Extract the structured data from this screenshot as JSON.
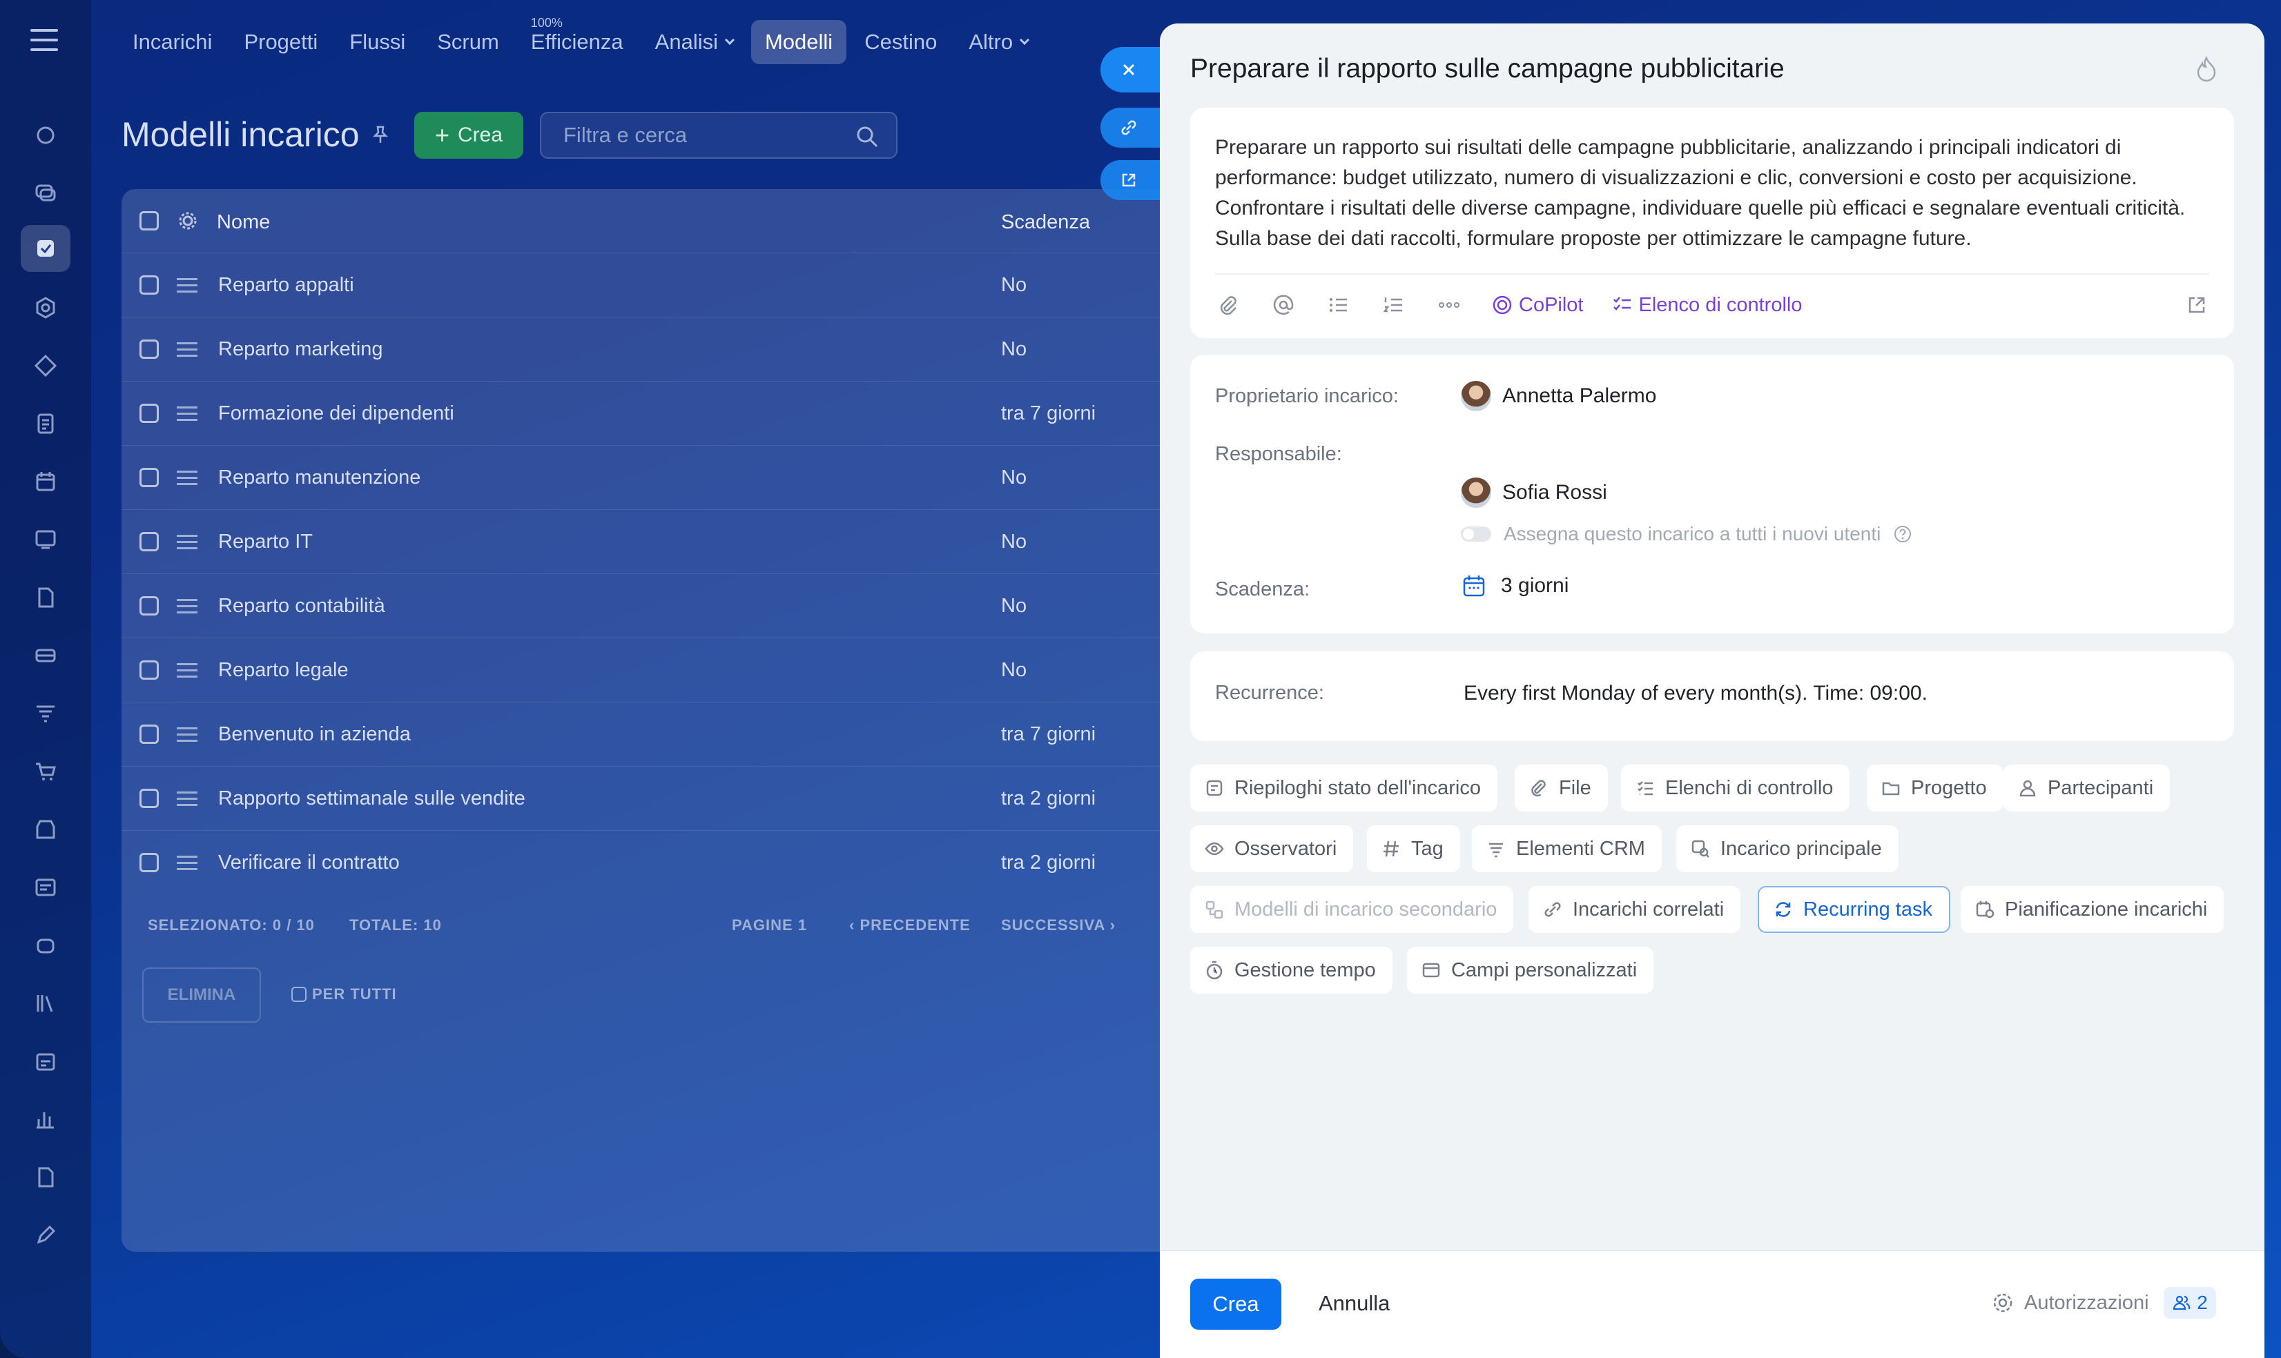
{
  "nav": {
    "items": [
      "Incarichi",
      "Progetti",
      "Flussi",
      "Scrum",
      "Efficienza",
      "Analisi",
      "Modelli",
      "Cestino",
      "Altro"
    ],
    "efficiency_sup": "100%"
  },
  "page": {
    "title": "Modelli incarico",
    "create_label": "Crea",
    "search_placeholder": "Filtra e cerca"
  },
  "grid": {
    "col_name": "Nome",
    "col_due": "Scadenza",
    "rows": [
      {
        "name": "Reparto appalti",
        "due": "No"
      },
      {
        "name": "Reparto marketing",
        "due": "No"
      },
      {
        "name": "Formazione dei dipendenti",
        "due": "tra 7 giorni"
      },
      {
        "name": "Reparto manutenzione",
        "due": "No"
      },
      {
        "name": "Reparto IT",
        "due": "No"
      },
      {
        "name": "Reparto contabilità",
        "due": "No"
      },
      {
        "name": "Reparto legale",
        "due": "No"
      },
      {
        "name": "Benvenuto in azienda",
        "due": "tra 7 giorni"
      },
      {
        "name": "Rapporto settimanale sulle vendite",
        "due": "tra 2 giorni"
      },
      {
        "name": "Verificare il contratto",
        "due": "tra 2 giorni"
      }
    ],
    "footer": {
      "selected": "SELEZIONATO: 0 / 10",
      "total": "TOTALE: 10",
      "pages": "PAGINE  1",
      "prev": "PRECEDENTE",
      "next": "SUCCESSIVA",
      "delete": "ELIMINA",
      "for_all": "PER TUTTI"
    }
  },
  "panel": {
    "title": "Preparare il rapporto sulle campagne pubblicitarie",
    "description": "Preparare un rapporto sui risultati delle campagne pubblicitarie, analizzando i principali indicatori di performance: budget utilizzato, numero di visualizzazioni e clic, conversioni e costo per acquisizione. Confrontare i risultati delle diverse campagne, individuare quelle più efficaci e segnalare eventuali criticità. Sulla base dei dati raccolti, formulare proposte per ottimizzare le campagne future.",
    "copilot": "CoPilot",
    "checklist": "Elenco di controllo",
    "owner_label": "Proprietario incarico:",
    "owner": "Annetta Palermo",
    "responsible_label": "Responsabile:",
    "responsible": "Sofia Rossi",
    "assign_all": "Assegna questo incarico a tutti i nuovi utenti",
    "deadline_label": "Scadenza:",
    "deadline": "3 giorni",
    "recurrence_label": "Recurrence:",
    "recurrence": "Every first Monday of every month(s). Time: 09:00.",
    "chips": [
      "Riepiloghi stato dell'incarico",
      "File",
      "Elenchi di controllo",
      "Progetto",
      "Partecipanti",
      "Osservatori",
      "Tag",
      "Elementi CRM",
      "Incarico principale",
      "Modelli di incarico secondario",
      "Incarichi correlati",
      "Recurring task",
      "Pianificazione incarichi",
      "Gestione tempo",
      "Campi personalizzati"
    ],
    "create": "Crea",
    "cancel": "Annulla",
    "permissions": "Autorizzazioni",
    "permissions_count": "2"
  },
  "colors": {
    "accent": "#0a72ef",
    "copilot": "#7a3fd8",
    "create_green": "#1f8a5a"
  }
}
